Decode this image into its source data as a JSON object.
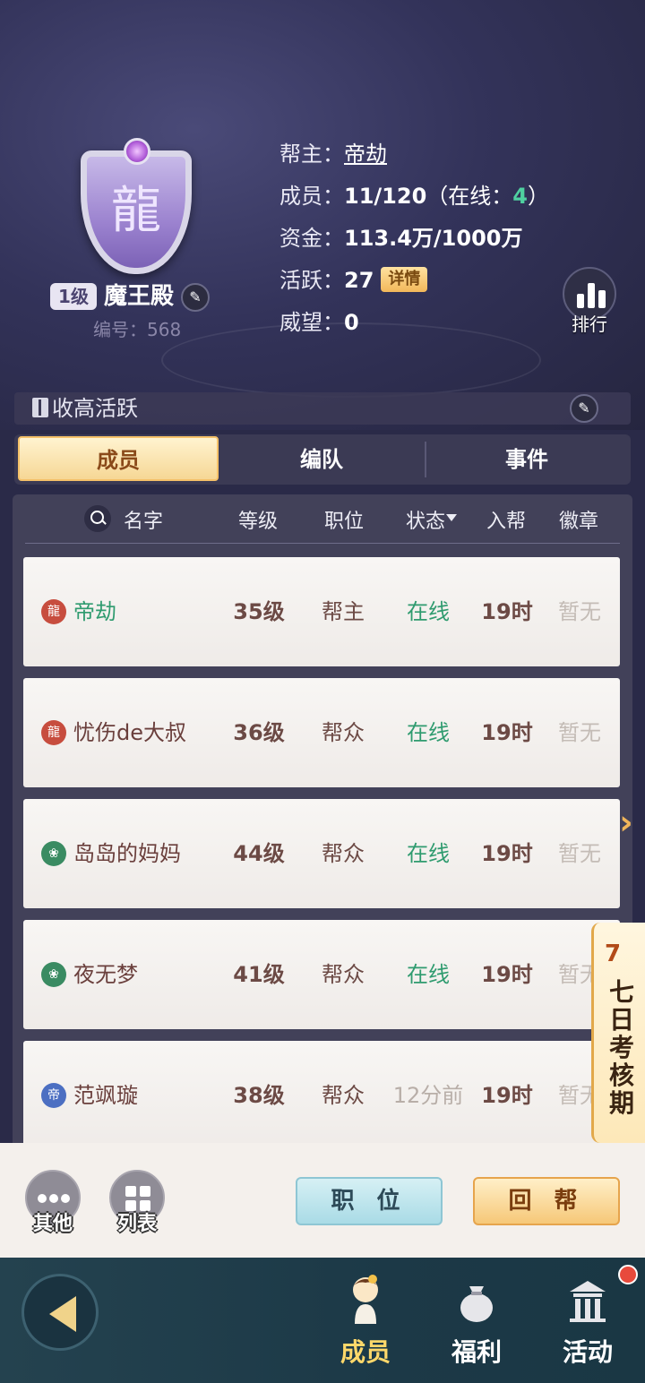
{
  "guild": {
    "level": "1级",
    "name": "魔王殿",
    "id_label": "编号：",
    "id_value": "568"
  },
  "info": {
    "leader_key": "帮主：",
    "leader_val": "帝劫",
    "members_key": "成员：",
    "members_val": "11/120",
    "online_open": "（在线：",
    "online_count": "4",
    "online_close": "）",
    "funds_key": "资金：",
    "funds_val": "113.4万/1000万",
    "active_key": "活跃：",
    "active_val": "27",
    "detail_label": "详情",
    "prestige_key": "威望：",
    "prestige_val": "0"
  },
  "rank_label": "排行",
  "notice_text": "收高活跃",
  "tabs": [
    {
      "label": "成员"
    },
    {
      "label": "编队"
    },
    {
      "label": "事件"
    }
  ],
  "table_header": {
    "name": "名字",
    "level": "等级",
    "position": "职位",
    "status": "状态",
    "join": "入帮",
    "badge": "徽章"
  },
  "members": [
    {
      "name": "帝劫",
      "level": "35级",
      "position": "帮主",
      "status": "在线",
      "join": "19时",
      "badge": "暂无"
    },
    {
      "name": "忧伤de大叔",
      "level": "36级",
      "position": "帮众",
      "status": "在线",
      "join": "19时",
      "badge": "暂无"
    },
    {
      "name": "岛岛的妈妈",
      "level": "44级",
      "position": "帮众",
      "status": "在线",
      "join": "19时",
      "badge": "暂无"
    },
    {
      "name": "夜无梦",
      "level": "41级",
      "position": "帮众",
      "status": "在线",
      "join": "19时",
      "badge": "暂无"
    },
    {
      "name": "范飒璇",
      "level": "38级",
      "position": "帮众",
      "status": "12分前",
      "join": "19时",
      "badge": "暂无"
    }
  ],
  "event_banner": {
    "number": "7",
    "text": "七日考核期"
  },
  "actions": {
    "other": "其他",
    "list": "列表",
    "position_btn": "职 位",
    "return_btn": "回 帮"
  },
  "nav": {
    "members": "成员",
    "welfare": "福利",
    "activity": "活动"
  },
  "colors": {
    "online": "#2f9b6f",
    "accent_gold": "#f6c878",
    "accent_blue": "#a9dbe6"
  }
}
